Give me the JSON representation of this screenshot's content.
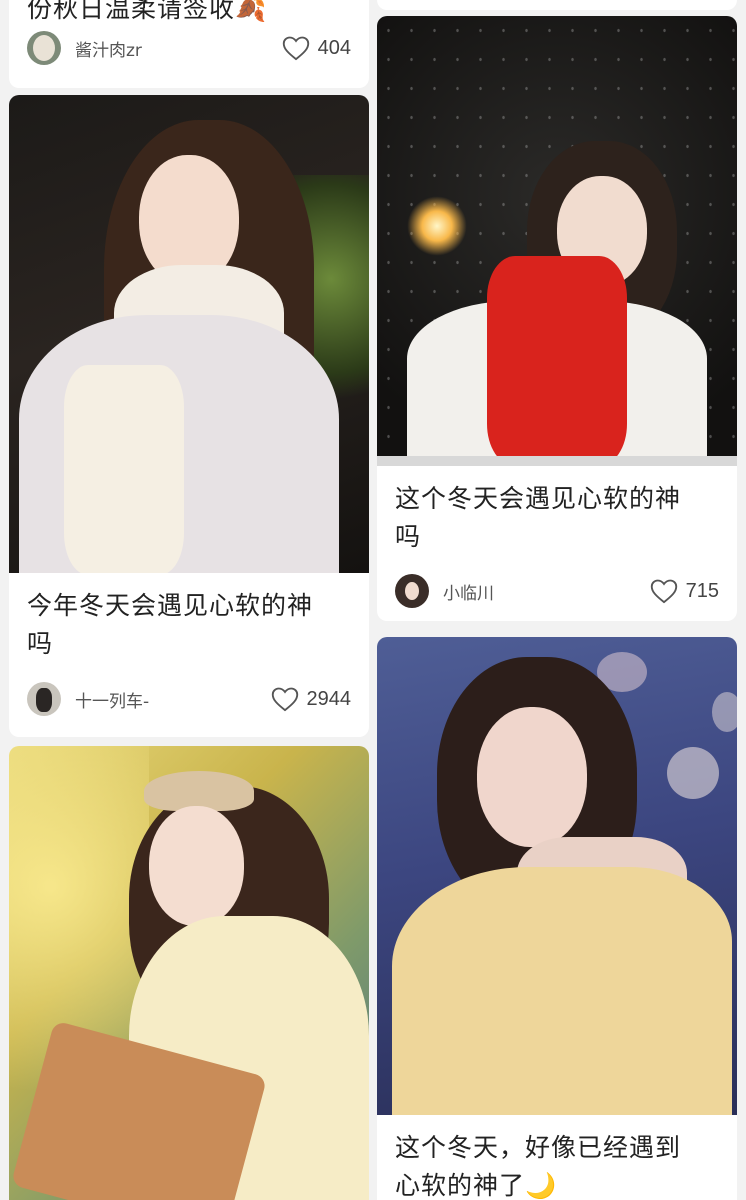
{
  "cards": [
    {
      "title": "份秋日温柔请签收🍂",
      "author": "酱汁肉zr",
      "likes": "404"
    },
    {
      "title": "",
      "author": "",
      "likes": ""
    },
    {
      "title_line1": "今年冬天会遇见心软的神",
      "title_line2": "吗",
      "author": "十一列车-",
      "likes": "2944"
    },
    {
      "title_line1": "这个冬天会遇见心软的神",
      "title_line2": "吗",
      "author": "小临川",
      "likes": "715"
    },
    {
      "title_line1": "",
      "title_line2": "",
      "author": "",
      "likes": ""
    },
    {
      "title_line1": "这个冬天，好像已经遇到",
      "title_line2": "心软的神了🌙",
      "author": "",
      "likes": ""
    }
  ],
  "icons": {
    "like": "heart-outline-icon",
    "avatar": "user-avatar"
  },
  "colors": {
    "background": "#f2f2f2",
    "card": "#ffffff",
    "text": "#222222",
    "muted": "#555555"
  }
}
